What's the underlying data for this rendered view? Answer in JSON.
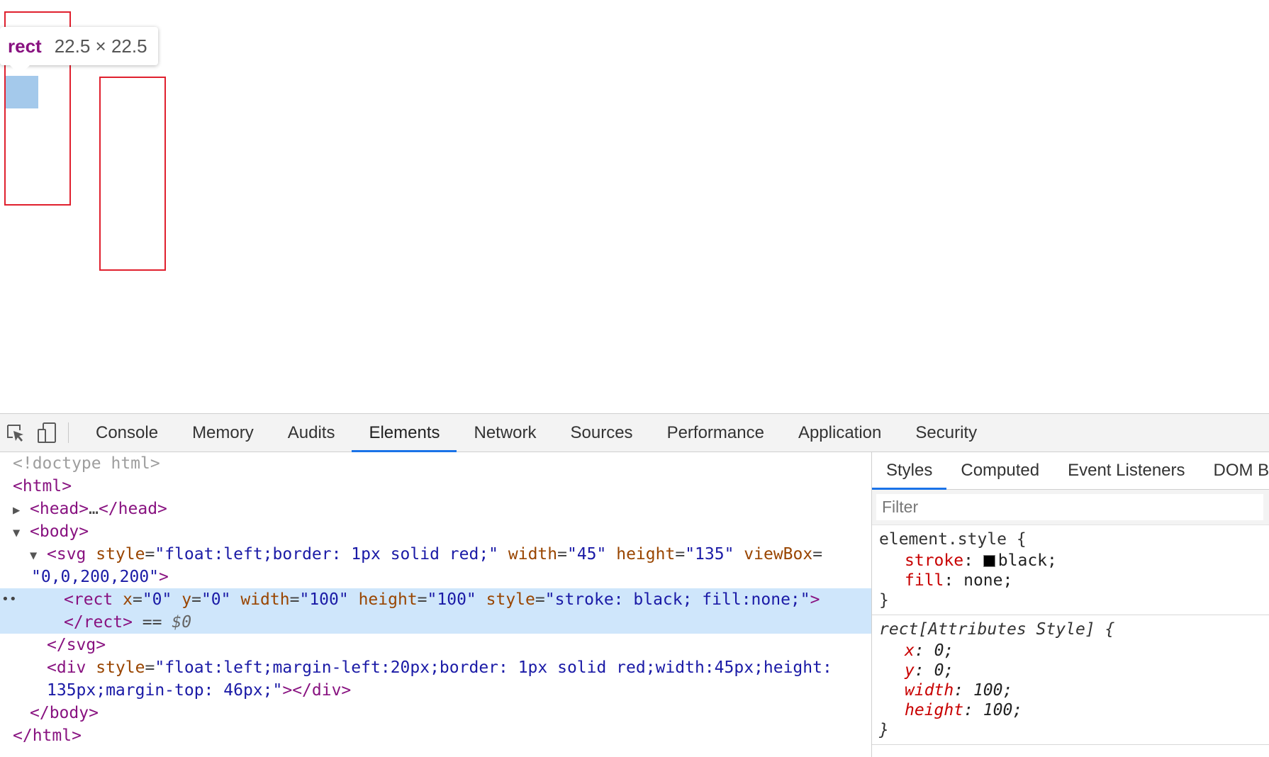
{
  "tooltip": {
    "tag": "rect",
    "size": "22.5 × 22.5"
  },
  "toolbar": {
    "tabs": [
      "Console",
      "Memory",
      "Audits",
      "Elements",
      "Network",
      "Sources",
      "Performance",
      "Application",
      "Security"
    ],
    "active_tab": "Elements"
  },
  "dom": {
    "doctype": "<!doctype html>",
    "html_open": "<html>",
    "head_open": "<head>",
    "head_ellipsis": "…",
    "head_close": "</head>",
    "body_open": "<body>",
    "svg": {
      "open": "<svg",
      "attrs": [
        {
          "name": "style",
          "value": "\"float:left;border: 1px solid red;\""
        },
        {
          "name": "width",
          "value": "\"45\""
        },
        {
          "name": "height",
          "value": "\"135\""
        },
        {
          "name": "viewBox",
          "value": "\"0,0,200,200\""
        }
      ],
      "close": "</svg>"
    },
    "rect": {
      "open": "<rect",
      "attrs": [
        {
          "name": "x",
          "value": "\"0\""
        },
        {
          "name": "y",
          "value": "\"0\""
        },
        {
          "name": "width",
          "value": "\"100\""
        },
        {
          "name": "height",
          "value": "\"100\""
        },
        {
          "name": "style",
          "value": "\"stroke: black; fill:none;\""
        }
      ],
      "close": "</rect>",
      "selected_marker": "== ",
      "selected_var": "$0"
    },
    "div": {
      "open": "<div",
      "attr_name": "style",
      "attr_value_1": "\"float:left;margin-left:20px;border: 1px solid red;width:45px;height:",
      "attr_value_2": "135px;margin-top: 46px;\"",
      "close": "></div>"
    },
    "body_close": "</body>",
    "html_close": "</html>"
  },
  "sidebar": {
    "tabs": [
      "Styles",
      "Computed",
      "Event Listeners",
      "DOM B"
    ],
    "active_tab": "Styles",
    "filter_placeholder": "Filter",
    "element_style": {
      "selector": "element.style {",
      "props": [
        {
          "name": "stroke",
          "value": "black;",
          "swatch": "#000000"
        },
        {
          "name": "fill",
          "value": "none;"
        }
      ],
      "close": "}"
    },
    "attributes_style": {
      "selector": "rect[Attributes Style] {",
      "props": [
        {
          "name": "x",
          "value": "0;"
        },
        {
          "name": "y",
          "value": "0;"
        },
        {
          "name": "width",
          "value": "100;"
        },
        {
          "name": "height",
          "value": "100;"
        }
      ],
      "close": "}"
    }
  },
  "colors": {
    "tag": "#881280",
    "attr_name": "#994500",
    "attr_value": "#1a1aa6",
    "selection": "#cfe6fb",
    "highlight": "#9fc6ea",
    "border_red": "#e0202e",
    "tab_underline": "#1a73e8"
  }
}
